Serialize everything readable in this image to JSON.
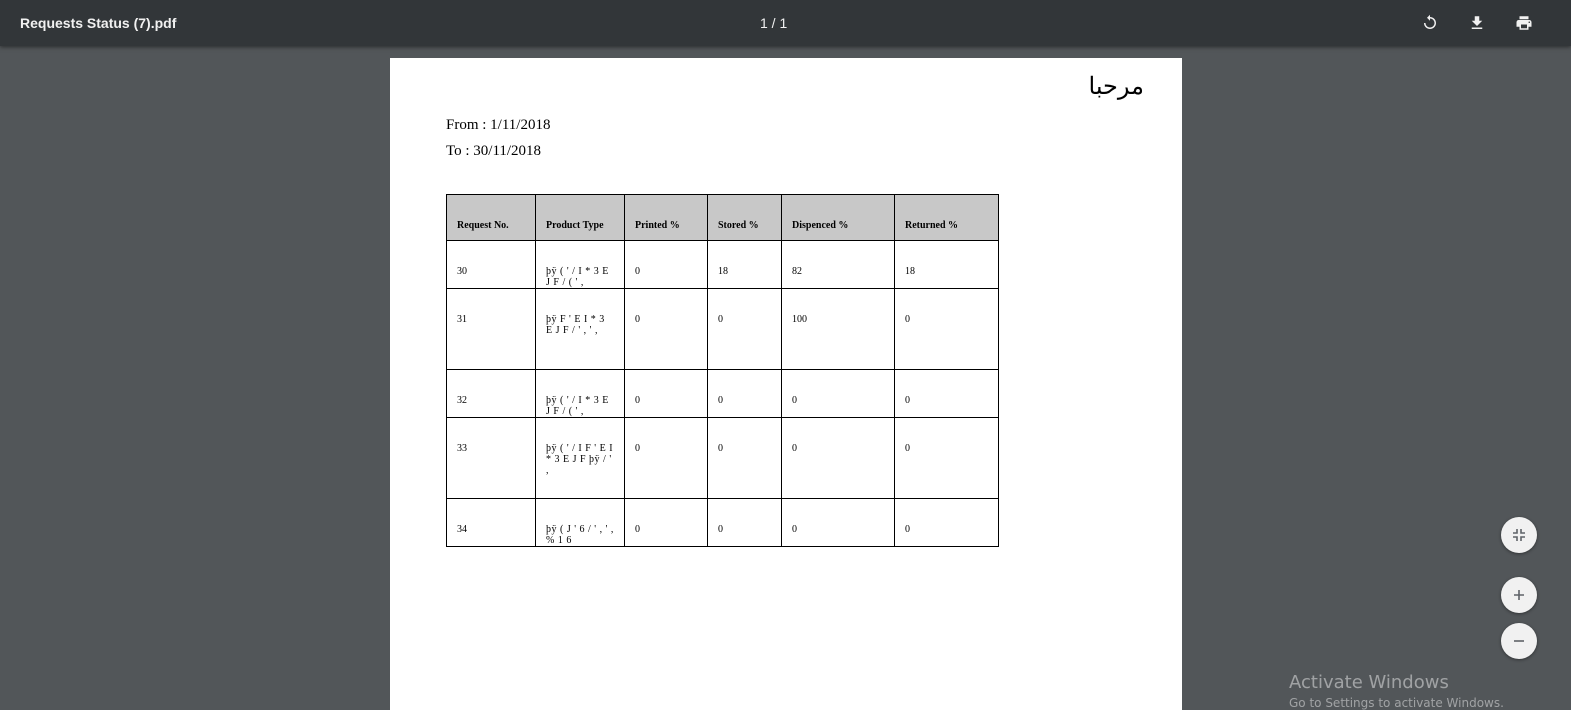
{
  "toolbar": {
    "title": "Requests Status (7).pdf",
    "page_indicator": "1 / 1",
    "rotate_icon": "rotate-icon",
    "download_icon": "download-icon",
    "print_icon": "print-icon"
  },
  "document": {
    "greeting": "مرحبا",
    "from": "From : 1/11/2018",
    "to": "To : 30/11/2018",
    "table": {
      "headers": [
        "Request No.",
        "Product Type",
        "Printed %",
        "Stored %",
        "Dispenced %",
        "Returned %"
      ],
      "rows": [
        [
          "30",
          "þÿ ( ' / I   * 3 E J F   / ( ' ,",
          "0",
          "18",
          "82",
          "18"
        ],
        [
          "31",
          "þÿ F ' E I   * 3 E J F   / ' , ' ,",
          "0",
          "0",
          "100",
          "0"
        ],
        [
          "32",
          "þÿ ( ' / I   * 3 E J F   / ( ' ,",
          "0",
          "0",
          "0",
          "0"
        ],
        [
          "33",
          "þÿ ( ' / I   F ' E I   * 3 E J F   þÿ / ' ,",
          "0",
          "0",
          "0",
          "0"
        ],
        [
          "34",
          "þÿ ( J ' 6   / ' , ' ,   % 1 6",
          "0",
          "0",
          "0",
          "0"
        ]
      ]
    }
  },
  "controls": {
    "fit_icon": "fit-page-icon",
    "zoom_in_icon": "zoom-in-icon",
    "zoom_out_icon": "zoom-out-icon"
  },
  "watermark": {
    "title": "Activate Windows",
    "subtitle": "Go to Settings to activate Windows."
  }
}
